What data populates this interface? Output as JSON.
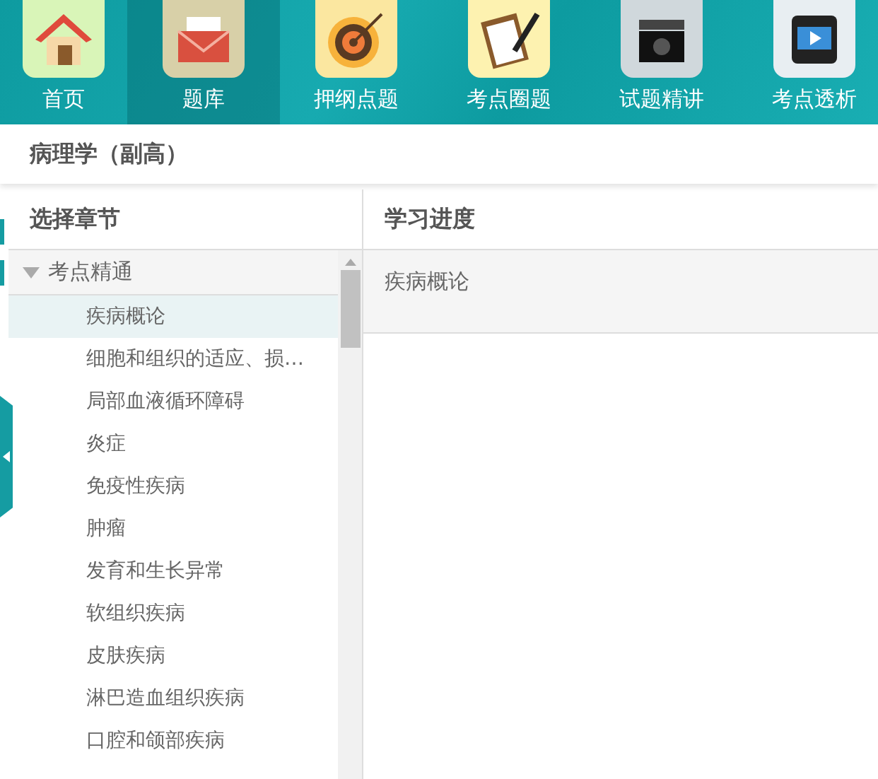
{
  "nav": [
    {
      "label": "首页",
      "selected": false
    },
    {
      "label": "题库",
      "selected": true
    },
    {
      "label": "押纲点题",
      "selected": false
    },
    {
      "label": "考点圈题",
      "selected": false
    },
    {
      "label": "试题精讲",
      "selected": false
    },
    {
      "label": "考点透析",
      "selected": false
    }
  ],
  "page_title": "病理学（副高）",
  "chapters": {
    "heading": "选择章节",
    "tree": [
      {
        "label": "考点精通",
        "expanded": true,
        "children": [
          {
            "label": "疾病概论",
            "selected": true
          },
          {
            "label": "细胞和组织的适应、损…",
            "selected": false
          },
          {
            "label": "局部血液循环障碍",
            "selected": false
          },
          {
            "label": "炎症",
            "selected": false
          },
          {
            "label": "免疫性疾病",
            "selected": false
          },
          {
            "label": "肿瘤",
            "selected": false
          },
          {
            "label": "发育和生长异常",
            "selected": false
          },
          {
            "label": "软组织疾病",
            "selected": false
          },
          {
            "label": "皮肤疾病",
            "selected": false
          },
          {
            "label": "淋巴造血组织疾病",
            "selected": false
          },
          {
            "label": "口腔和颌部疾病",
            "selected": false
          }
        ]
      }
    ]
  },
  "progress": {
    "heading": "学习进度",
    "rows": [
      "疾病概论"
    ]
  }
}
